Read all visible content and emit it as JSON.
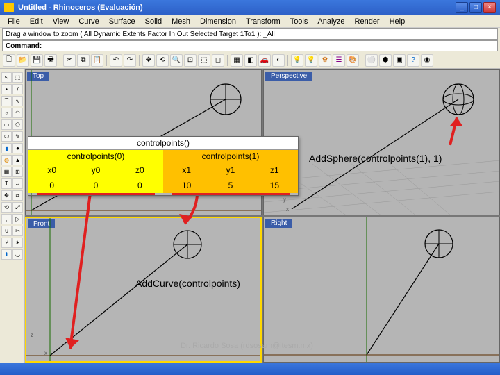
{
  "window": {
    "title": "Untitled - Rhinoceros (Evaluación)"
  },
  "menu": [
    "File",
    "Edit",
    "View",
    "Curve",
    "Surface",
    "Solid",
    "Mesh",
    "Dimension",
    "Transform",
    "Tools",
    "Analyze",
    "Render",
    "Help"
  ],
  "prompt": "Drag a window to zoom ( All  Dynamic  Extents  Factor  In  Out  Selected  Target  1To1 ):  _All",
  "command": {
    "label": "Command:",
    "value": ""
  },
  "viewports": {
    "top": "Top",
    "perspective": "Perspective",
    "front": "Front",
    "right": "Right"
  },
  "table": {
    "header": "controlpoints()",
    "left_label": "controlpoints(0)",
    "right_label": "controlpoints(1)",
    "left_cols": [
      "x0",
      "y0",
      "z0"
    ],
    "right_cols": [
      "x1",
      "y1",
      "z1"
    ],
    "left_vals": [
      "0",
      "0",
      "0"
    ],
    "right_vals": [
      "10",
      "5",
      "15"
    ]
  },
  "annotations": {
    "sphere": "AddSphere(controlpoints(1), 1)",
    "curve": "AddCurve(controlpoints)"
  },
  "axes": {
    "x": "x",
    "y": "y",
    "z": "z"
  },
  "credit": "Dr. Ricardo Sosa (rdsosam@itesm.mx)"
}
